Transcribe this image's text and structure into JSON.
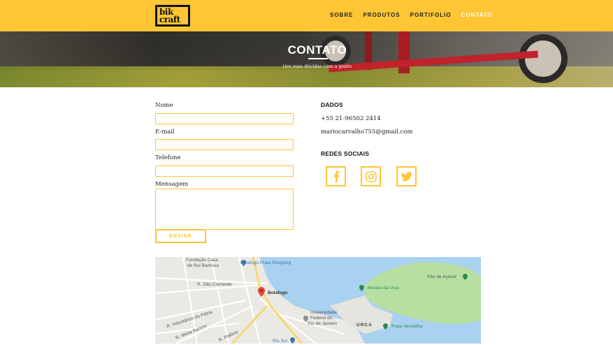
{
  "header": {
    "logo_line1": "bik",
    "logo_line2": "craft",
    "nav": [
      "SOBRE",
      "PRODUTOS",
      "PORTIFOLIO",
      "CONTATO"
    ],
    "active_nav": "CONTATO"
  },
  "hero": {
    "title": "CONTATO",
    "subtitle": "tire suas dúvidas com a gente"
  },
  "form": {
    "name_label": "Nome",
    "email_label": "E-mail",
    "phone_label": "Telefone",
    "message_label": "Mensagem",
    "submit_label": "ENVIAR"
  },
  "dados": {
    "heading": "DADOS",
    "phone": "+55 21-96502 2414",
    "email": "mariocarvalho755@gmail.com"
  },
  "redes": {
    "heading": "REDES SOCIAIS",
    "icons": [
      "facebook-icon",
      "instagram-icon",
      "twitter-icon"
    ]
  },
  "map": {
    "labels": {
      "fundacao1": "Fundação Casa",
      "fundacao2": "de Rui Barbosa",
      "botafogo_shopping": "Botafogo Praia Shopping",
      "sao_clemente": "R. São Clemente",
      "botafogo": "Botafogo",
      "pao_de_acucar": "Pão de Açúcar",
      "mureta": "Mureta da Urca",
      "voluntarios": "R. Voluntários da Pátria",
      "ufrj1": "Universidade",
      "ufrj2": "Federal do",
      "ufrj3": "Rio de Janeiro",
      "urca": "URCA",
      "praia_vermelha": "Praia Vermelha",
      "mena_barreto": "R. Mena Barreto",
      "rio_sul": "Rio Sul",
      "polonio": "R. Polônio"
    }
  },
  "colors": {
    "brand_yellow": "#fec634",
    "water": "#a9d1f0",
    "park": "#b8dfa2"
  }
}
